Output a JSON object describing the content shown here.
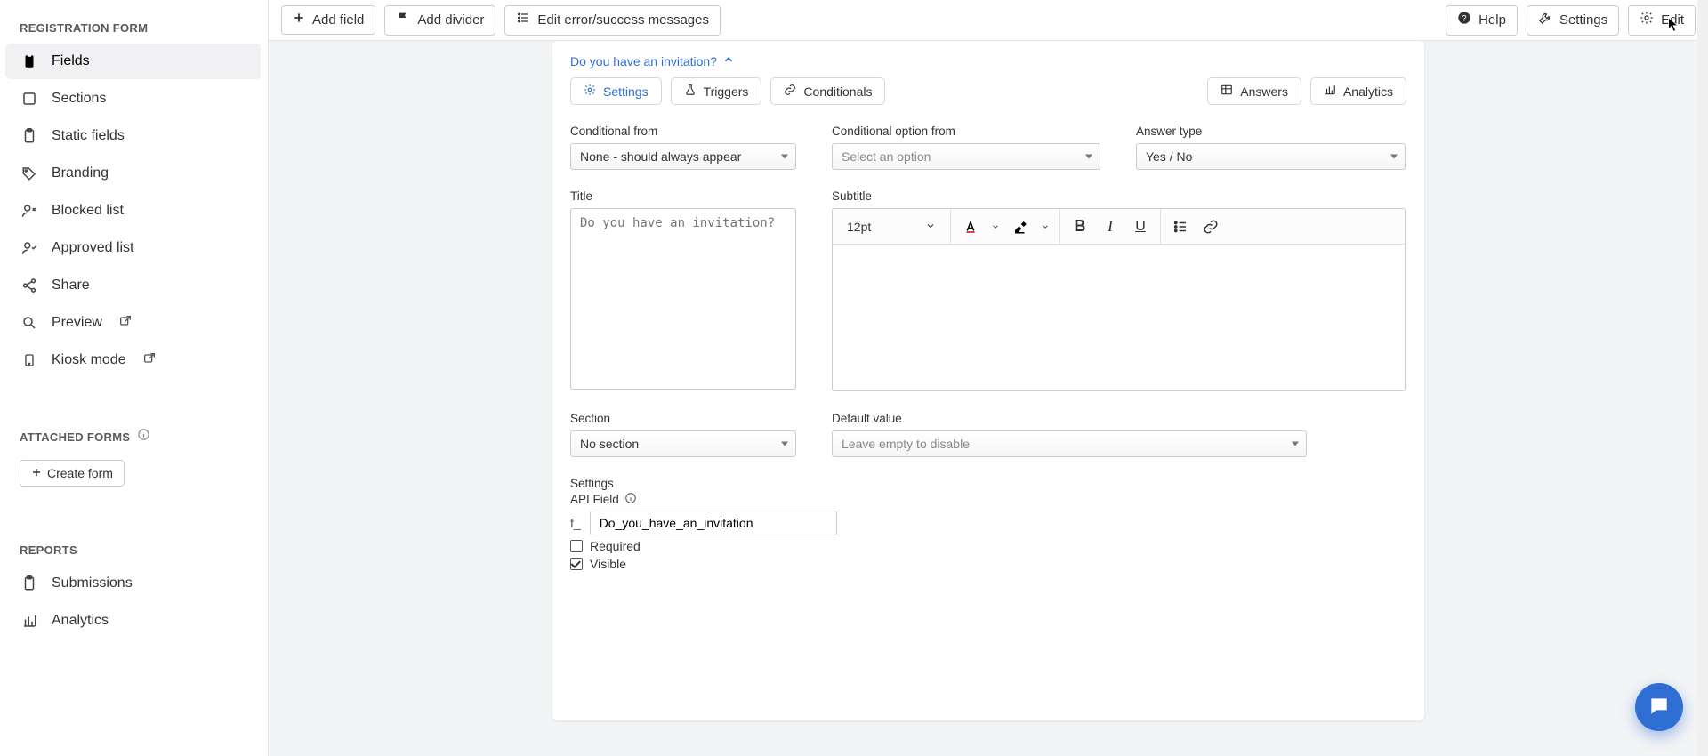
{
  "sidebar": {
    "section1_title": "REGISTRATION FORM",
    "items": [
      {
        "label": "Fields",
        "icon": "clipboard",
        "active": true
      },
      {
        "label": "Sections",
        "icon": "square",
        "active": false
      },
      {
        "label": "Static fields",
        "icon": "clipboard",
        "active": false
      },
      {
        "label": "Branding",
        "icon": "tag",
        "active": false
      },
      {
        "label": "Blocked list",
        "icon": "user-x",
        "active": false
      },
      {
        "label": "Approved list",
        "icon": "user-check",
        "active": false
      },
      {
        "label": "Share",
        "icon": "share",
        "active": false
      },
      {
        "label": "Preview",
        "icon": "search",
        "active": false,
        "ext": true
      },
      {
        "label": "Kiosk mode",
        "icon": "tablet",
        "active": false,
        "ext": true
      }
    ],
    "section2_title": "ATTACHED FORMS",
    "create_form_label": "Create form",
    "section3_title": "REPORTS",
    "report_items": [
      {
        "label": "Submissions",
        "icon": "clipboard"
      },
      {
        "label": "Analytics",
        "icon": "chart"
      }
    ]
  },
  "topbar": {
    "add_field": "Add field",
    "add_divider": "Add divider",
    "edit_messages": "Edit error/success messages",
    "help": "Help",
    "settings": "Settings",
    "edit": "Edit"
  },
  "editor": {
    "crumb": "Do you have an invitation?",
    "tabs": {
      "settings": "Settings",
      "triggers": "Triggers",
      "conditionals": "Conditionals",
      "answers": "Answers",
      "analytics": "Analytics"
    },
    "labels": {
      "conditional_from": "Conditional from",
      "conditional_option_from": "Conditional option from",
      "answer_type": "Answer type",
      "title": "Title",
      "subtitle": "Subtitle",
      "section": "Section",
      "default_value": "Default value",
      "settings": "Settings",
      "api_field": "API Field",
      "required": "Required",
      "visible": "Visible"
    },
    "values": {
      "conditional_from": "None - should always appear",
      "conditional_option_from": "Select an option",
      "answer_type": "Yes / No",
      "title": "Do you have an invitation?",
      "section": "No section",
      "default_value": "Leave empty to disable",
      "api_prefix": "f_",
      "api_field": "Do_you_have_an_invitation",
      "required_checked": false,
      "visible_checked": true,
      "font_size": "12pt"
    }
  }
}
